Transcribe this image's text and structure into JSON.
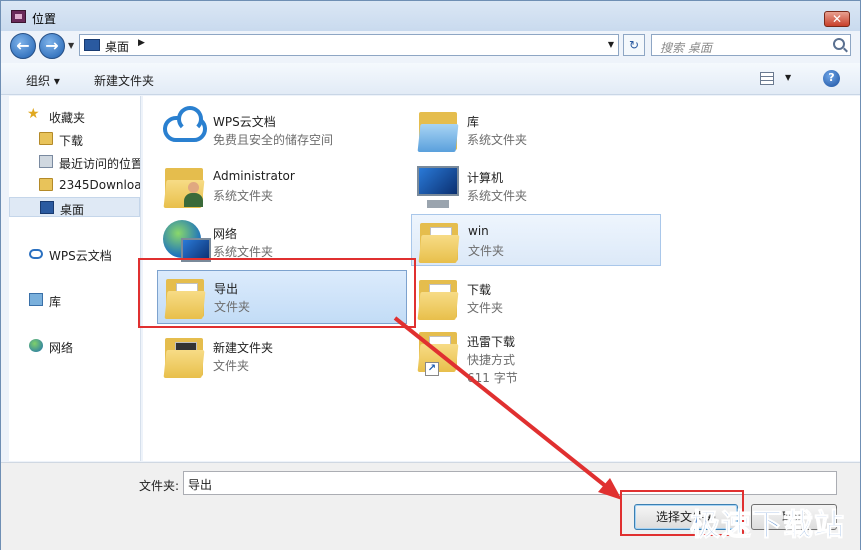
{
  "window": {
    "title": "位置",
    "close_label": "✕"
  },
  "nav": {
    "back_glyph": "←",
    "forward_glyph": "→",
    "address": "桌面",
    "address_sep": "▶",
    "dropdown_glyph": "▼",
    "refresh_glyph": "↻",
    "search_placeholder": "搜索 桌面"
  },
  "toolbar": {
    "organize": "组织 ▾",
    "new_folder": "新建文件夹",
    "view_dd": "▼",
    "help": "?"
  },
  "sidebar": {
    "items": [
      {
        "label": "收藏夹",
        "icon": "star-icon"
      },
      {
        "label": "下载",
        "icon": "download-folder-icon"
      },
      {
        "label": "最近访问的位置",
        "icon": "recent-places-icon"
      },
      {
        "label": "2345Downloa",
        "icon": "folder-icon"
      },
      {
        "label": "桌面",
        "icon": "desktop-icon"
      },
      {
        "label": "WPS云文档",
        "icon": "cloud-icon"
      },
      {
        "label": "库",
        "icon": "library-icon"
      },
      {
        "label": "网络",
        "icon": "network-icon"
      }
    ]
  },
  "files": [
    {
      "name": "WPS云文档",
      "sub": "免费且安全的储存空间",
      "icon": "cloud-icon"
    },
    {
      "name": "库",
      "sub": "系统文件夹",
      "icon": "library-icon"
    },
    {
      "name": "Administrator",
      "sub": "系统文件夹",
      "icon": "user-folder-icon"
    },
    {
      "name": "计算机",
      "sub": "系统文件夹",
      "icon": "computer-icon"
    },
    {
      "name": "网络",
      "sub": "系统文件夹",
      "icon": "network-icon"
    },
    {
      "name": "win",
      "sub": "文件夹",
      "icon": "folder-icon"
    },
    {
      "name": "导出",
      "sub": "文件夹",
      "icon": "folder-icon"
    },
    {
      "name": "下载",
      "sub": "文件夹",
      "icon": "folder-icon"
    },
    {
      "name": "新建文件夹",
      "sub": "文件夹",
      "icon": "folder-icon"
    },
    {
      "name": "迅雷下载",
      "sub": "快捷方式",
      "sub2": "611 字节",
      "icon": "shortcut-folder-icon"
    }
  ],
  "bottom": {
    "folder_label": "文件夹:",
    "folder_value": "导出",
    "select_button": "选择文件夹",
    "cancel_button": "取消"
  },
  "watermark": "极速下载站",
  "colors": {
    "highlight": "#e03030",
    "selection": "#c2dcf6",
    "accent": "#2a5aa0"
  }
}
